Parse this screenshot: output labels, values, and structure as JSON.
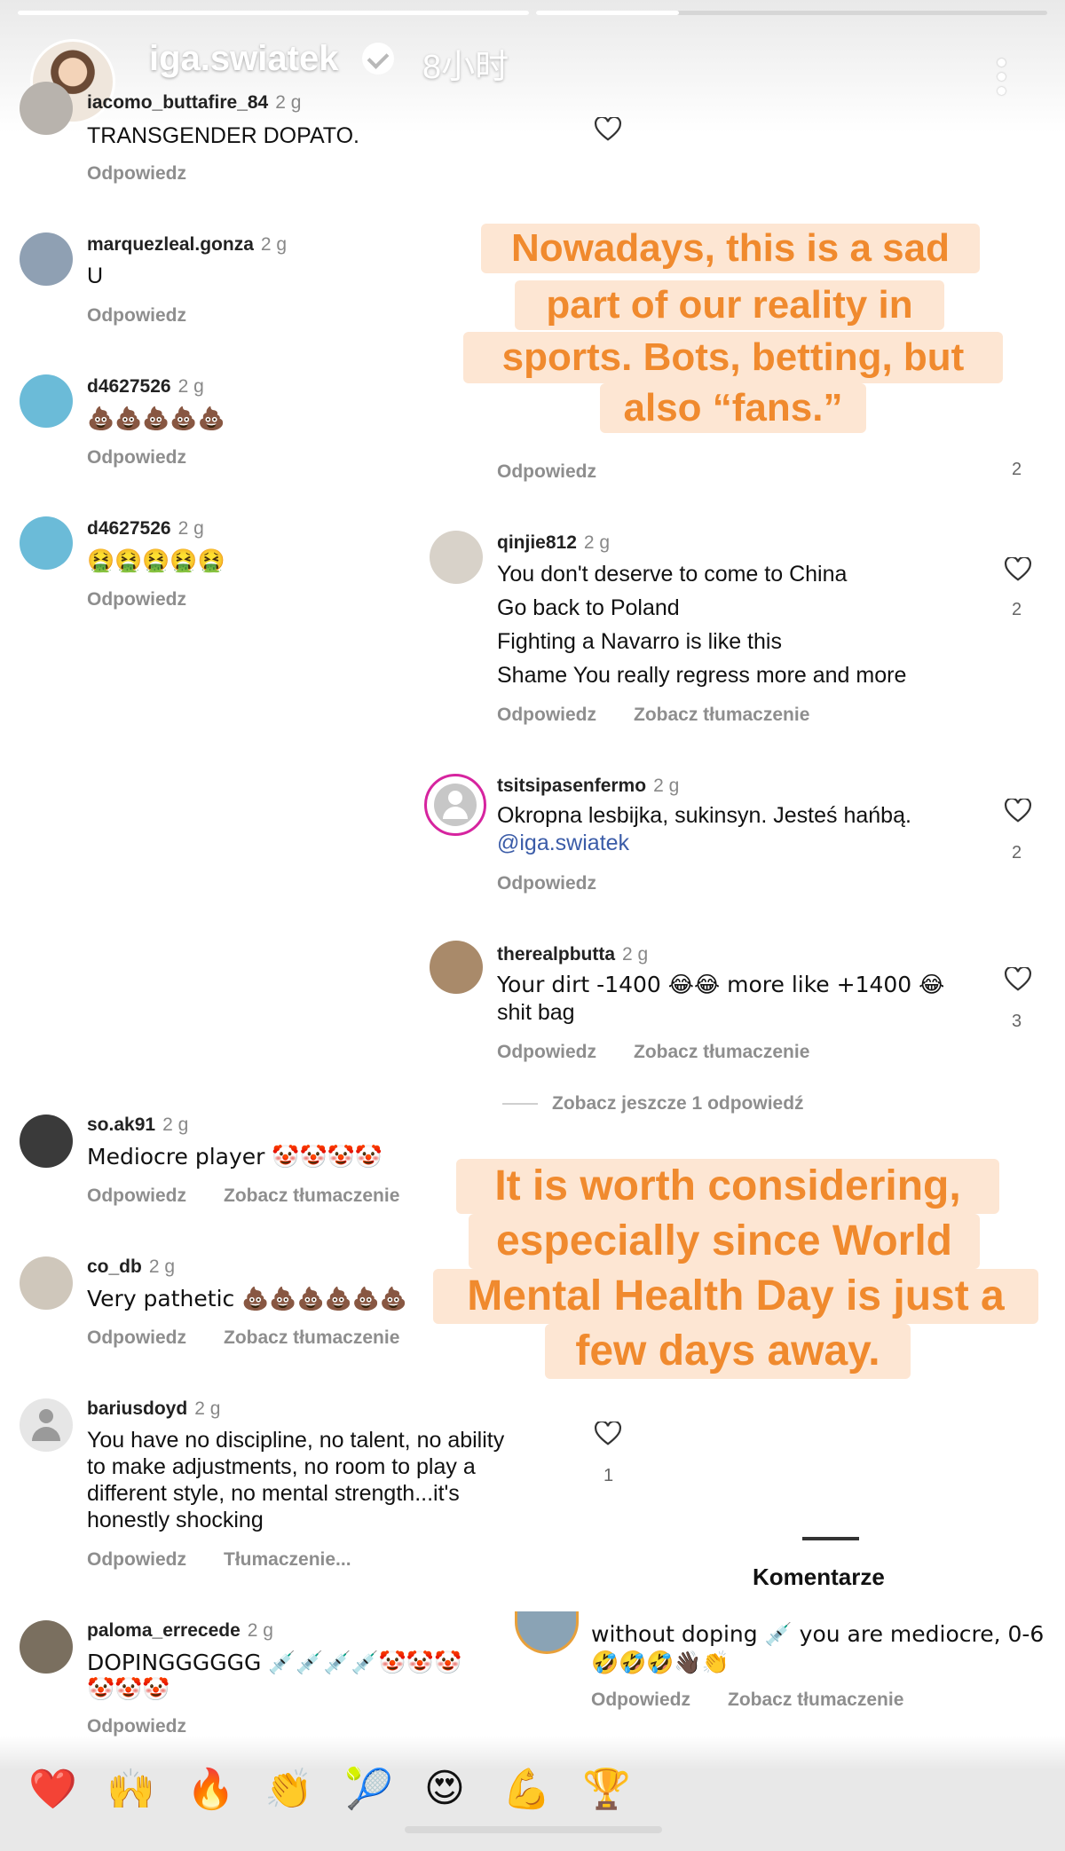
{
  "story": {
    "username": "iga.swiatek",
    "time": "8小时"
  },
  "left_comments": [
    {
      "user": "iacomo_buttafire_84",
      "time": "2 g",
      "text": "TRANSGENDER DOPATO.",
      "reply": "Odpowiedz"
    },
    {
      "user": "marquezleal.gonza",
      "time": "2 g",
      "text": "U",
      "reply": "Odpowiedz"
    },
    {
      "user": "d4627526",
      "time": "2 g",
      "text": "💩💩💩💩💩",
      "reply": "Odpowiedz"
    },
    {
      "user": "d4627526",
      "time": "2 g",
      "text": "🤮🤮🤮🤮🤮",
      "reply": "Odpowiedz"
    },
    {
      "user": "so.ak91",
      "time": "2 g",
      "text": "Mediocre player 🤡🤡🤡🤡",
      "reply": "Odpowiedz",
      "translate": "Zobacz tłumaczenie"
    },
    {
      "user": "co_db",
      "time": "2 g",
      "text": "Very pathetic 💩💩💩💩💩💩",
      "reply": "Odpowiedz",
      "translate": "Zobacz tłumaczenie"
    },
    {
      "user": "bariusdoyd",
      "time": "2 g",
      "lines": [
        "You have no discipline, no talent, no ability",
        "to make adjustments, no room to play a",
        "different style, no mental strength...it's",
        "honestly shocking"
      ],
      "reply": "Odpowiedz",
      "translate": "Tłumaczenie...",
      "likes": "1"
    },
    {
      "user": "paloma_errecede",
      "time": "2 g",
      "lines": [
        "DOPINGGGGGG 💉💉💉💉🤡🤡🤡",
        "🤡🤡🤡"
      ],
      "reply": "Odpowiedz"
    }
  ],
  "right_comments": [
    {
      "reply": "Odpowiedz",
      "likes": "2"
    },
    {
      "user": "qinjie812",
      "time": "2 g",
      "lines": [
        "You don't deserve to come to China",
        "Go back to Poland",
        "Fighting a Navarro is like this",
        "Shame You really regress more and more"
      ],
      "reply": "Odpowiedz",
      "translate": "Zobacz tłumaczenie",
      "likes": "2"
    },
    {
      "user": "tsitsipasenfermo",
      "time": "2 g",
      "text": "Okropna lesbijka, sukinsyn. Jesteś hańbą.",
      "mention": "@iga.swiatek",
      "reply": "Odpowiedz",
      "likes": "2"
    },
    {
      "user": "therealpbutta",
      "time": "2 g",
      "lines": [
        "Your dirt -1400 😂😂 more like +1400 😂",
        "shit bag"
      ],
      "reply": "Odpowiedz",
      "translate": "Zobacz tłumaczenie",
      "likes": "3"
    }
  ],
  "more_replies": "Zobacz jeszcze 1 odpowiedź",
  "bottom_panel": {
    "title": "Komentarze",
    "lines": [
      "without doping 💉 you are mediocre, 0-6",
      "🤣🤣🤣👋🏿👏"
    ],
    "reply": "Odpowiedz",
    "translate": "Zobacz tłumaczenie"
  },
  "overlays": {
    "top": [
      "Nowadays, this is a sad",
      "part of our reality in",
      "sports. Bots, betting, but",
      "also “fans.”"
    ],
    "bottom": [
      "It is worth considering,",
      "especially since World",
      "Mental Health Day is just a",
      "few days away."
    ]
  },
  "reactions": [
    "❤️",
    "🙌",
    "🔥",
    "👏",
    "🎾",
    "😍",
    "💪",
    "🏆"
  ],
  "colors": {
    "overlay_text": "#f08a2e",
    "overlay_bg": "#fde6d3",
    "mention": "#3b5ca8",
    "muted": "#8e8e8e"
  }
}
